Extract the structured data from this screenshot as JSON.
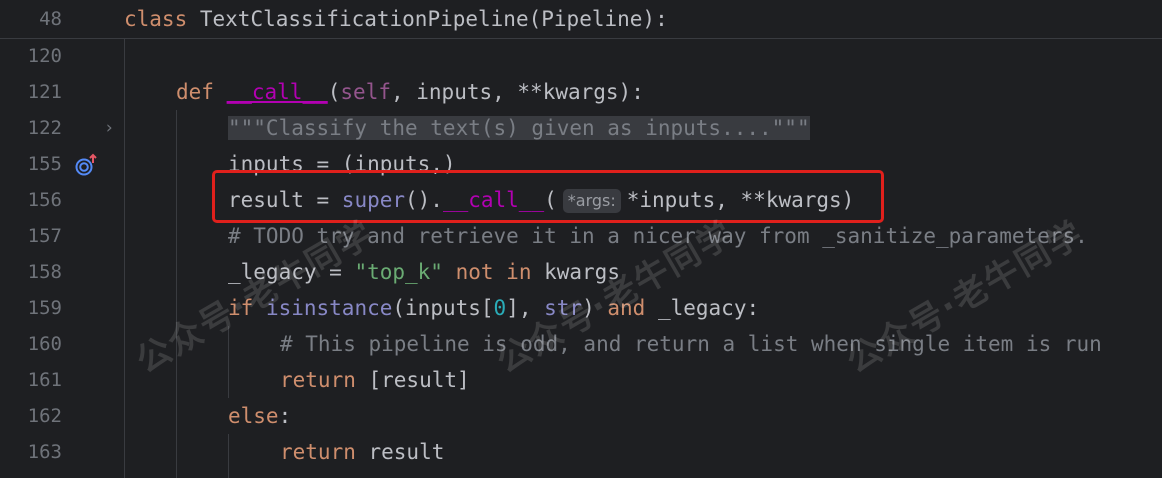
{
  "sticky_line": {
    "number": "48",
    "keyword": "class",
    "name": "TextClassificationPipeline",
    "paren_open": "(",
    "base": "Pipeline",
    "paren_close": "):"
  },
  "lines": [
    {
      "number": "120"
    },
    {
      "number": "121",
      "keyword": "def",
      "fn": "__call__",
      "p_open": "(",
      "self": "self",
      "rest": ", inputs, **kwargs):"
    },
    {
      "number": "122",
      "doc": "\"\"\"Classify the text(s) given as inputs....\"\"\""
    },
    {
      "number": "155",
      "text": "inputs = (inputs,)"
    },
    {
      "number": "156",
      "pre": "result = ",
      "builtin": "super",
      "mid": "().",
      "fn": "__call__",
      "p_open": "(",
      "hint": "*args:",
      "post": "*inputs, **kwargs)"
    },
    {
      "number": "157",
      "comment": "# TODO try and retrieve it in a nicer way from _sanitize_parameters."
    },
    {
      "number": "158",
      "pre": "_legacy = ",
      "str": "\"top_k\"",
      "kw1": " not ",
      "kw2": "in",
      "post": " kwargs"
    },
    {
      "number": "159",
      "kw": "if",
      "builtin": "isinstance",
      "a": "(inputs[",
      "num": "0",
      "b": "], ",
      "builtin2": "str",
      "c": ") ",
      "kw2": "and",
      "d": " _legacy:"
    },
    {
      "number": "160",
      "comment": "# This pipeline is odd, and return a list when single item is run"
    },
    {
      "number": "161",
      "kw": "return",
      "post": " [result]"
    },
    {
      "number": "162",
      "kw": "else",
      "post": ":"
    },
    {
      "number": "163",
      "kw": "return",
      "post": " result"
    }
  ],
  "icons": {
    "implements": "override-up-icon",
    "fold": "chevron-right-icon"
  },
  "watermark": "公众号·老牛同学",
  "colors": {
    "background": "#1e1f22",
    "highlight": "#e0201c"
  }
}
